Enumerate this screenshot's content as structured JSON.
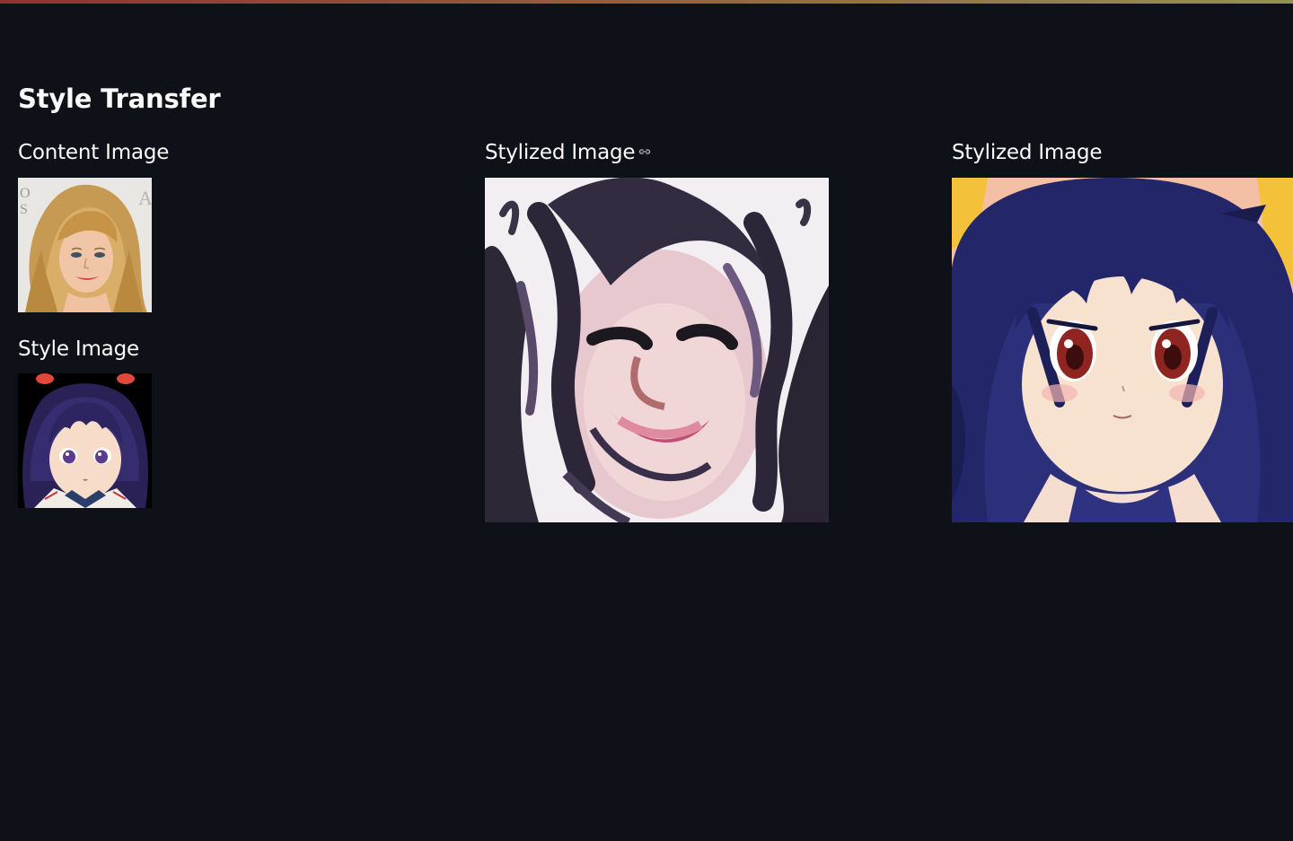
{
  "page": {
    "title": "Style Transfer"
  },
  "left_column": {
    "content_heading": "Content Image",
    "style_heading": "Style Image"
  },
  "middle_column": {
    "heading": "Stylized Image"
  },
  "right_column": {
    "heading": "Stylized Image"
  },
  "colors": {
    "background": "#0e1117",
    "text": "#fafafa"
  },
  "icons": {
    "heading_anchor": "link-icon"
  }
}
